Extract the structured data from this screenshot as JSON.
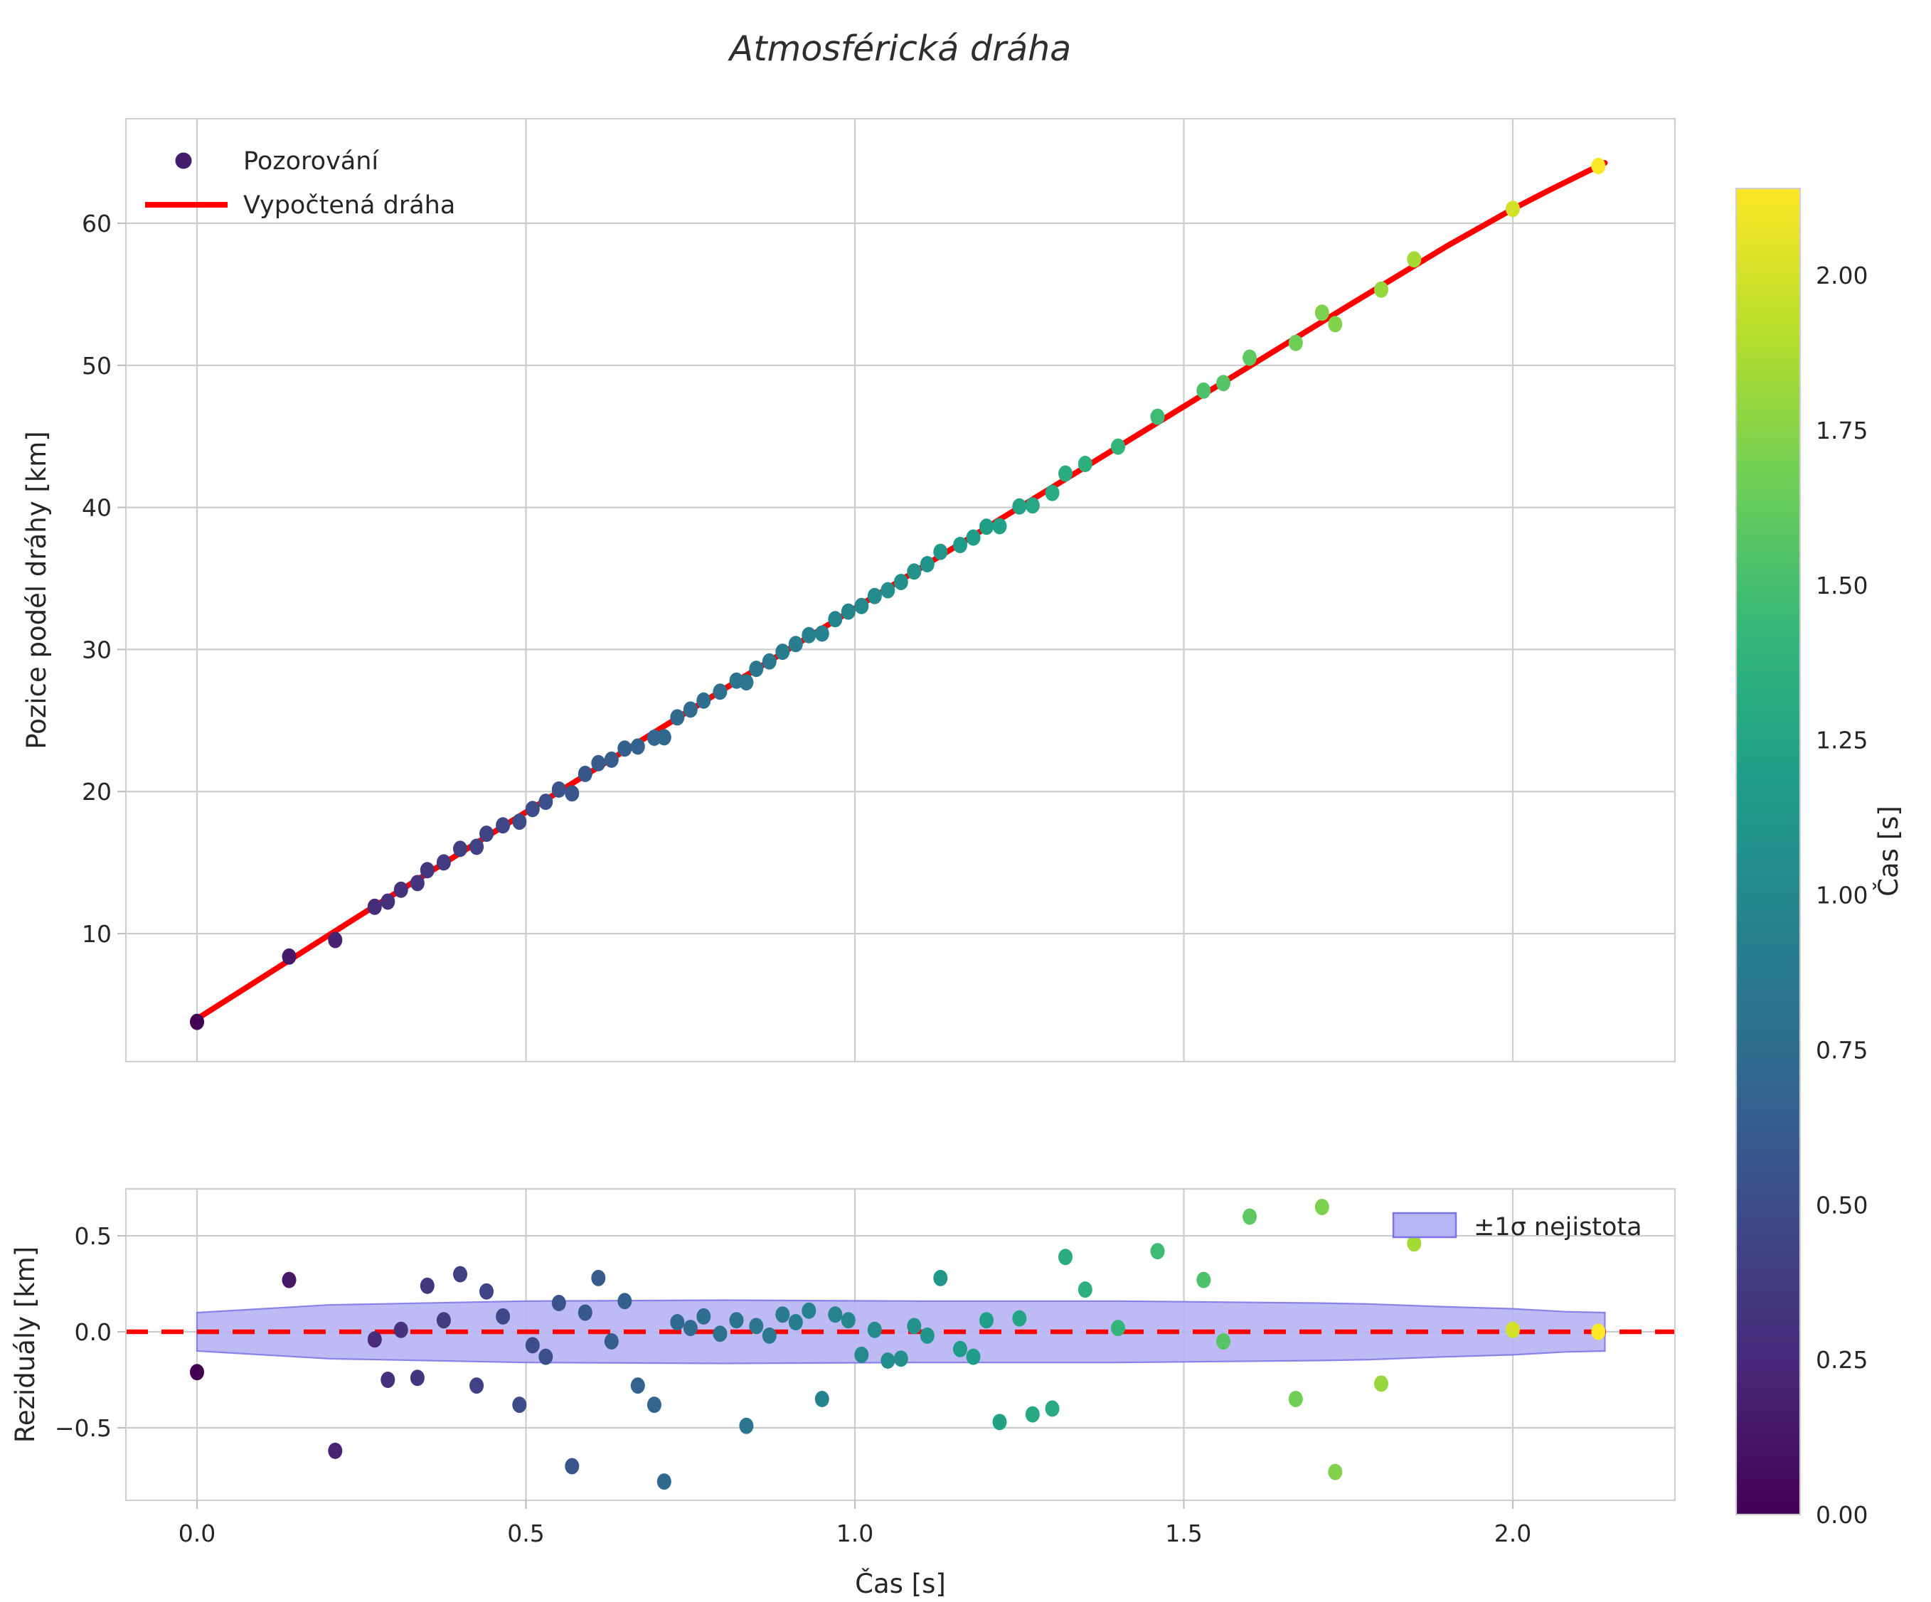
{
  "chart_data": {
    "type": "scatter",
    "title": "Atmosférická dráha",
    "position_chart": {
      "type": "scatter+line",
      "ylabel": "Pozice podél dráhy [km]",
      "yticks": [
        10,
        20,
        30,
        40,
        50,
        60
      ],
      "ytick_labels": [
        "10",
        "20",
        "30",
        "40",
        "50",
        "60"
      ],
      "ylim": [
        1.0,
        67.4
      ],
      "xlim": [
        -0.11,
        2.25
      ],
      "grid": true,
      "legend": {
        "position": "upper left",
        "observations_label": "Pozorování",
        "fit_label": "Vypočtená dráha",
        "marker_color": "#451d6d"
      },
      "fit_line": {
        "color": "#ff0000",
        "t": [
          0,
          0.25,
          0.5,
          0.75,
          1.0,
          1.25,
          1.5,
          1.75,
          1.9,
          2.0,
          2.05,
          2.1,
          2.14
        ],
        "s": [
          4.0,
          11.35,
          18.55,
          25.75,
          32.9,
          40.0,
          47.1,
          54.2,
          58.4,
          61.0,
          62.2,
          63.35,
          64.25
        ]
      },
      "observations": {
        "color_by": "t (viridis)",
        "t": [
          0.0,
          0.14,
          0.21,
          0.27,
          0.29,
          0.31,
          0.335,
          0.35,
          0.375,
          0.4,
          0.425,
          0.44,
          0.465,
          0.49,
          0.51,
          0.53,
          0.55,
          0.57,
          0.59,
          0.61,
          0.63,
          0.65,
          0.67,
          0.695,
          0.71,
          0.73,
          0.75,
          0.77,
          0.795,
          0.82,
          0.835,
          0.85,
          0.87,
          0.89,
          0.91,
          0.93,
          0.95,
          0.97,
          0.99,
          1.01,
          1.03,
          1.05,
          1.07,
          1.09,
          1.11,
          1.13,
          1.16,
          1.18,
          1.2,
          1.22,
          1.25,
          1.27,
          1.3,
          1.32,
          1.35,
          1.4,
          1.46,
          1.53,
          1.56,
          1.6,
          1.67,
          1.71,
          1.73,
          1.8,
          1.85,
          2.0,
          2.13
        ],
        "s": [
          3.79,
          8.39,
          9.55,
          11.89,
          12.25,
          13.09,
          13.56,
          14.47,
          15.01,
          15.97,
          16.11,
          17.03,
          17.62,
          17.88,
          18.77,
          19.28,
          20.14,
          19.87,
          21.24,
          22.0,
          22.24,
          23.03,
          23.17,
          23.79,
          23.82,
          25.22,
          25.77,
          26.4,
          27.03,
          27.81,
          27.69,
          28.64,
          29.16,
          29.84,
          30.38,
          31.01,
          31.12,
          32.13,
          32.67,
          33.06,
          33.76,
          34.17,
          34.75,
          35.49,
          36.0,
          36.87,
          37.35,
          37.88,
          38.64,
          38.68,
          40.07,
          40.14,
          41.02,
          42.38,
          43.06,
          44.28,
          46.38,
          48.22,
          48.75,
          50.54,
          51.58,
          53.71,
          52.9,
          55.33,
          57.46,
          61.01,
          64.03
        ]
      }
    },
    "residual_chart": {
      "type": "scatter",
      "ylabel": "Reziduály [km]",
      "xlabel": "Čas [s]",
      "yticks": [
        0.5,
        0.0,
        -0.5
      ],
      "ytick_labels": [
        "0.5",
        "0.0",
        "−0.5"
      ],
      "xticks": [
        0.0,
        0.5,
        1.0,
        1.5,
        2.0
      ],
      "xtick_labels": [
        "0.0",
        "0.5",
        "1.0",
        "1.5",
        "2.0"
      ],
      "ylim": [
        -0.88,
        0.74
      ],
      "xlim": [
        -0.11,
        2.25
      ],
      "grid": true,
      "zero_line": {
        "y": 0,
        "style": "dashed",
        "color": "#ff0000"
      },
      "residuals": {
        "t": [
          0.0,
          0.14,
          0.21,
          0.27,
          0.29,
          0.31,
          0.335,
          0.35,
          0.375,
          0.4,
          0.425,
          0.44,
          0.465,
          0.49,
          0.51,
          0.53,
          0.55,
          0.57,
          0.59,
          0.61,
          0.63,
          0.65,
          0.67,
          0.695,
          0.71,
          0.73,
          0.75,
          0.77,
          0.795,
          0.82,
          0.835,
          0.85,
          0.87,
          0.89,
          0.91,
          0.93,
          0.95,
          0.97,
          0.99,
          1.01,
          1.03,
          1.05,
          1.07,
          1.09,
          1.11,
          1.13,
          1.16,
          1.18,
          1.2,
          1.22,
          1.25,
          1.27,
          1.3,
          1.32,
          1.35,
          1.4,
          1.46,
          1.53,
          1.56,
          1.6,
          1.67,
          1.71,
          1.73,
          1.8,
          1.85,
          2.0,
          2.13
        ],
        "r": [
          -0.21,
          0.27,
          -0.62,
          -0.04,
          -0.25,
          0.01,
          -0.24,
          0.24,
          0.06,
          0.3,
          -0.28,
          0.21,
          0.08,
          -0.38,
          -0.07,
          -0.13,
          0.15,
          -0.7,
          0.1,
          0.28,
          -0.05,
          0.16,
          -0.28,
          -0.38,
          -0.78,
          0.05,
          0.02,
          0.08,
          -0.01,
          0.06,
          -0.49,
          0.03,
          -0.02,
          0.09,
          0.05,
          0.11,
          -0.35,
          0.09,
          0.06,
          -0.12,
          0.01,
          -0.15,
          -0.14,
          0.03,
          -0.02,
          0.28,
          -0.09,
          -0.13,
          0.06,
          -0.47,
          0.07,
          -0.43,
          -0.4,
          0.39,
          0.22,
          0.02,
          0.42,
          0.27,
          -0.05,
          0.6,
          -0.35,
          0.65,
          -0.73,
          -0.27,
          0.46,
          0.01,
          0.0
        ]
      },
      "band": {
        "label": "±1σ nejistota",
        "legend_position": "upper right",
        "fill": "#b7b4f3",
        "edge": "#7a72e6",
        "t": [
          0,
          0.2,
          0.5,
          0.8,
          1.1,
          1.4,
          1.7,
          1.78,
          1.9,
          2.0,
          2.08,
          2.14
        ],
        "half_width": [
          0.1,
          0.14,
          0.16,
          0.165,
          0.16,
          0.16,
          0.15,
          0.145,
          0.13,
          0.12,
          0.105,
          0.1
        ]
      }
    },
    "colorbar": {
      "label": "Čas [s]",
      "vmin": 0.0,
      "vmax": 2.14,
      "ticks": [
        0.0,
        0.25,
        0.5,
        0.75,
        1.0,
        1.25,
        1.5,
        1.75,
        2.0
      ],
      "tick_labels": [
        "0.00",
        "0.25",
        "0.50",
        "0.75",
        "1.00",
        "1.25",
        "1.50",
        "1.75",
        "2.00"
      ],
      "colormap": "viridis",
      "colors": [
        "#440154",
        "#482878",
        "#3e4989",
        "#31688e",
        "#26828e",
        "#1f9e89",
        "#35b779",
        "#6ece58",
        "#b5de2b",
        "#fde725"
      ]
    },
    "style_colors": {
      "grid": "#cccccc",
      "spine": "#cfcfcf",
      "accent_red": "#ff0000",
      "text": "#262626"
    }
  }
}
